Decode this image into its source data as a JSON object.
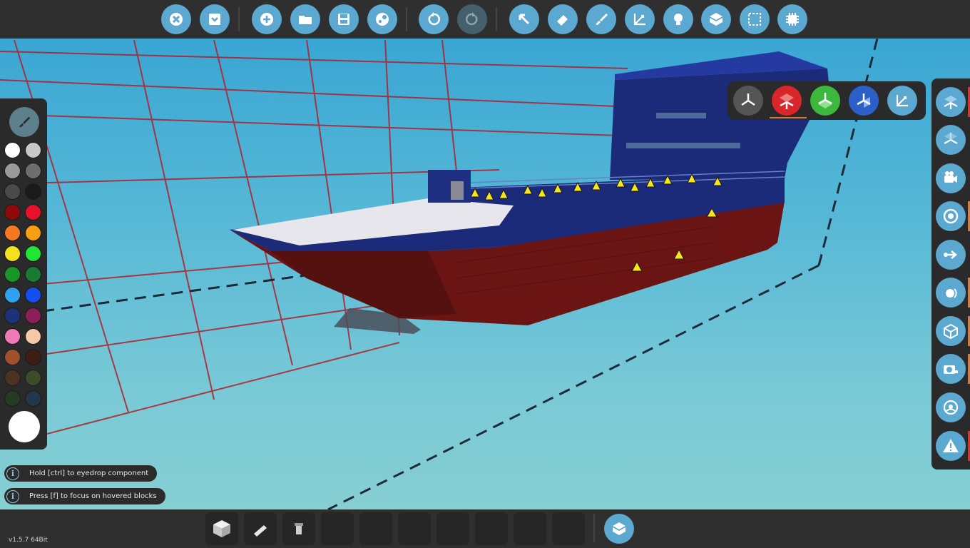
{
  "top_toolbar": {
    "buttons": [
      {
        "name": "close-icon",
        "enabled": true
      },
      {
        "name": "save-dropdown-icon",
        "enabled": true
      },
      {
        "name": "new-icon",
        "enabled": true
      },
      {
        "name": "open-folder-icon",
        "enabled": true
      },
      {
        "name": "save-disk-icon",
        "enabled": true
      },
      {
        "name": "steam-workshop-icon",
        "enabled": true
      },
      {
        "name": "undo-icon",
        "enabled": true
      },
      {
        "name": "redo-icon",
        "enabled": false
      },
      {
        "name": "select-cursor-icon",
        "enabled": true
      },
      {
        "name": "eraser-icon",
        "enabled": true
      },
      {
        "name": "paint-brush-icon",
        "enabled": true
      },
      {
        "name": "move-axis-icon",
        "enabled": true
      },
      {
        "name": "lightbulb-icon",
        "enabled": true
      },
      {
        "name": "logic-nodes-icon",
        "enabled": true
      },
      {
        "name": "selection-box-icon",
        "enabled": true
      },
      {
        "name": "microchip-icon",
        "enabled": true
      }
    ]
  },
  "palette": {
    "swatches": [
      "#ffffff",
      "#c8c8c8",
      "#9a9a9a",
      "#6e6e6e",
      "#4a4a4a",
      "#1a1a1a",
      "#8e0a0a",
      "#e8102a",
      "#f5781e",
      "#f5a014",
      "#f5e01e",
      "#1ee632",
      "#1a9628",
      "#1a7a32",
      "#32a0f0",
      "#1450f0",
      "#1e327a",
      "#8c1e5a",
      "#f078b4",
      "#f5c8a8",
      "#a0502d",
      "#3c1e14",
      "#4b3223",
      "#3c4b28",
      "#233c23",
      "#23374b"
    ],
    "current_color": "#ffffff"
  },
  "hints": [
    "Hold [ctrl] to eyedrop component",
    "Press [f] to focus on hovered blocks"
  ],
  "gizmo": {
    "buttons": [
      "view-all-axes-icon",
      "red-axis-icon",
      "green-axis-icon",
      "blue-axis-icon",
      "move-axis-icon"
    ],
    "active_index": 1
  },
  "right_panel": {
    "buttons": [
      "axis-view-icon",
      "axis-view-alt-icon",
      "camera-icon",
      "target-icon",
      "arrow-toggle-icon",
      "half-circle-icon",
      "xray-cube-icon",
      "photo-camera-icon",
      "vehicle-info-icon",
      "warning-icon"
    ]
  },
  "bottom_bar": {
    "slots": [
      "block-icon",
      "wedge-icon",
      "pipe-icon",
      "",
      "",
      "",
      "",
      "",
      "",
      ""
    ],
    "version": "v1.5.7 64Bit"
  },
  "colors": {
    "button_blue": "#5ba8d0",
    "toolbar_bg": "#2f2f2f",
    "hull_red": "#6a1414",
    "deck_blue": "#1c2a7a",
    "warning_yellow": "#f5e61e"
  }
}
